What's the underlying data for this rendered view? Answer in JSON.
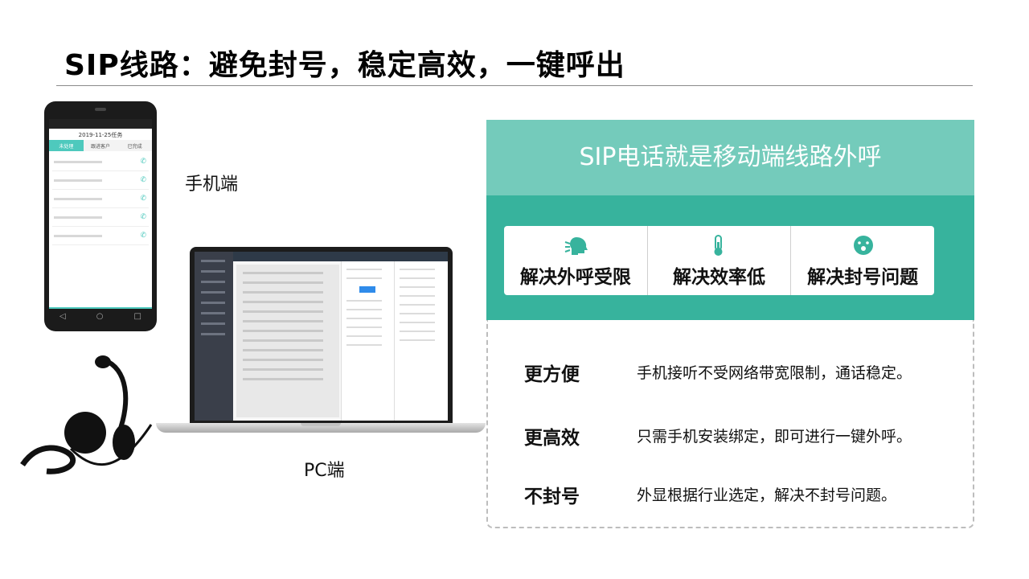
{
  "slide": {
    "title": "SIP线路：避免封号，稳定高效，一键呼出"
  },
  "devices": {
    "mobile_label": "手机端",
    "pc_label": "PC端",
    "phone_screen": {
      "date_title": "2019-11-25任务",
      "tabs": [
        "未处理",
        "跟进客户",
        "已完成"
      ]
    }
  },
  "banner": {
    "text": "SIP电话就是移动端线路外呼",
    "bg_color": "#74cbbb"
  },
  "features": [
    {
      "icon": "speaking-head-icon",
      "label": "解决外呼受限"
    },
    {
      "icon": "thermometer-icon",
      "label": "解决效率低"
    },
    {
      "icon": "shocked-face-icon",
      "label": "解决封号问题"
    }
  ],
  "band_color": "#37b39d",
  "benefits": [
    {
      "title": "更方便",
      "desc": "手机接听不受网络带宽限制，通话稳定。"
    },
    {
      "title": "更高效",
      "desc": "只需手机安装绑定，即可进行一键外呼。"
    },
    {
      "title": "不封号",
      "desc": "外显根据行业选定，解决不封号问题。"
    }
  ]
}
